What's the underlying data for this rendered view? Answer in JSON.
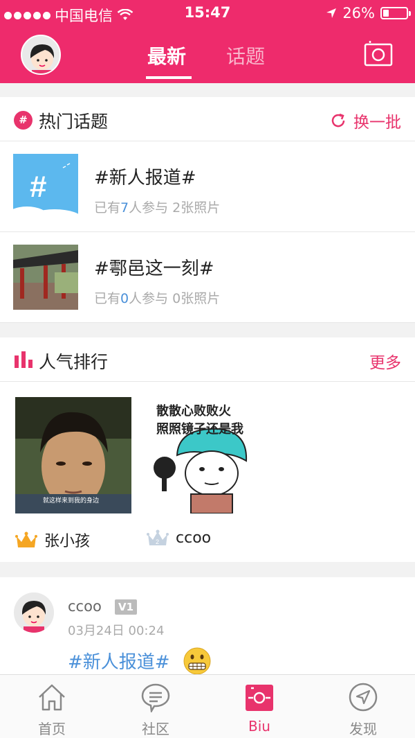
{
  "status_bar": {
    "carrier": "中国电信",
    "time": "15:47",
    "battery": "26%",
    "battery_level": 0.26
  },
  "header": {
    "tabs": [
      {
        "label": "最新",
        "active": true
      },
      {
        "label": "话题",
        "active": false
      }
    ],
    "avatar_icon": "avatar-girl-icon",
    "camera_icon": "camera-icon"
  },
  "hot_topics": {
    "title": "热门话题",
    "refresh_label": "换一批",
    "items": [
      {
        "title": "#新人报道#",
        "prefix": "已有",
        "count": "7",
        "suffix": "人参与",
        "photos": "2张照片"
      },
      {
        "title": "#鄠邑这一刻#",
        "prefix": "已有",
        "count": "0",
        "suffix": "人参与",
        "photos": "0张照片"
      }
    ]
  },
  "ranking": {
    "title": "人气排行",
    "more_label": "更多",
    "items": [
      {
        "name": "张小孩",
        "rank": "1",
        "caption": "就这样来到我的身边"
      },
      {
        "name": "ccoo",
        "rank": "2",
        "meme_line1": "散散心败败火",
        "meme_line2": "照照镜子还是我"
      }
    ]
  },
  "post": {
    "user": "ccoo",
    "badge": "V1",
    "time": "03月24日 00:24",
    "topic": "#新人报道#"
  },
  "tab_bar": [
    {
      "label": "首页",
      "icon": "home-icon",
      "active": false
    },
    {
      "label": "社区",
      "icon": "chat-bubble-icon",
      "active": false
    },
    {
      "label": "Biu",
      "icon": "biu-camera-icon",
      "active": true
    },
    {
      "label": "发现",
      "icon": "compass-icon",
      "active": false
    }
  ],
  "colors": {
    "brand": "#ee2b6c",
    "link": "#4a90d9"
  }
}
